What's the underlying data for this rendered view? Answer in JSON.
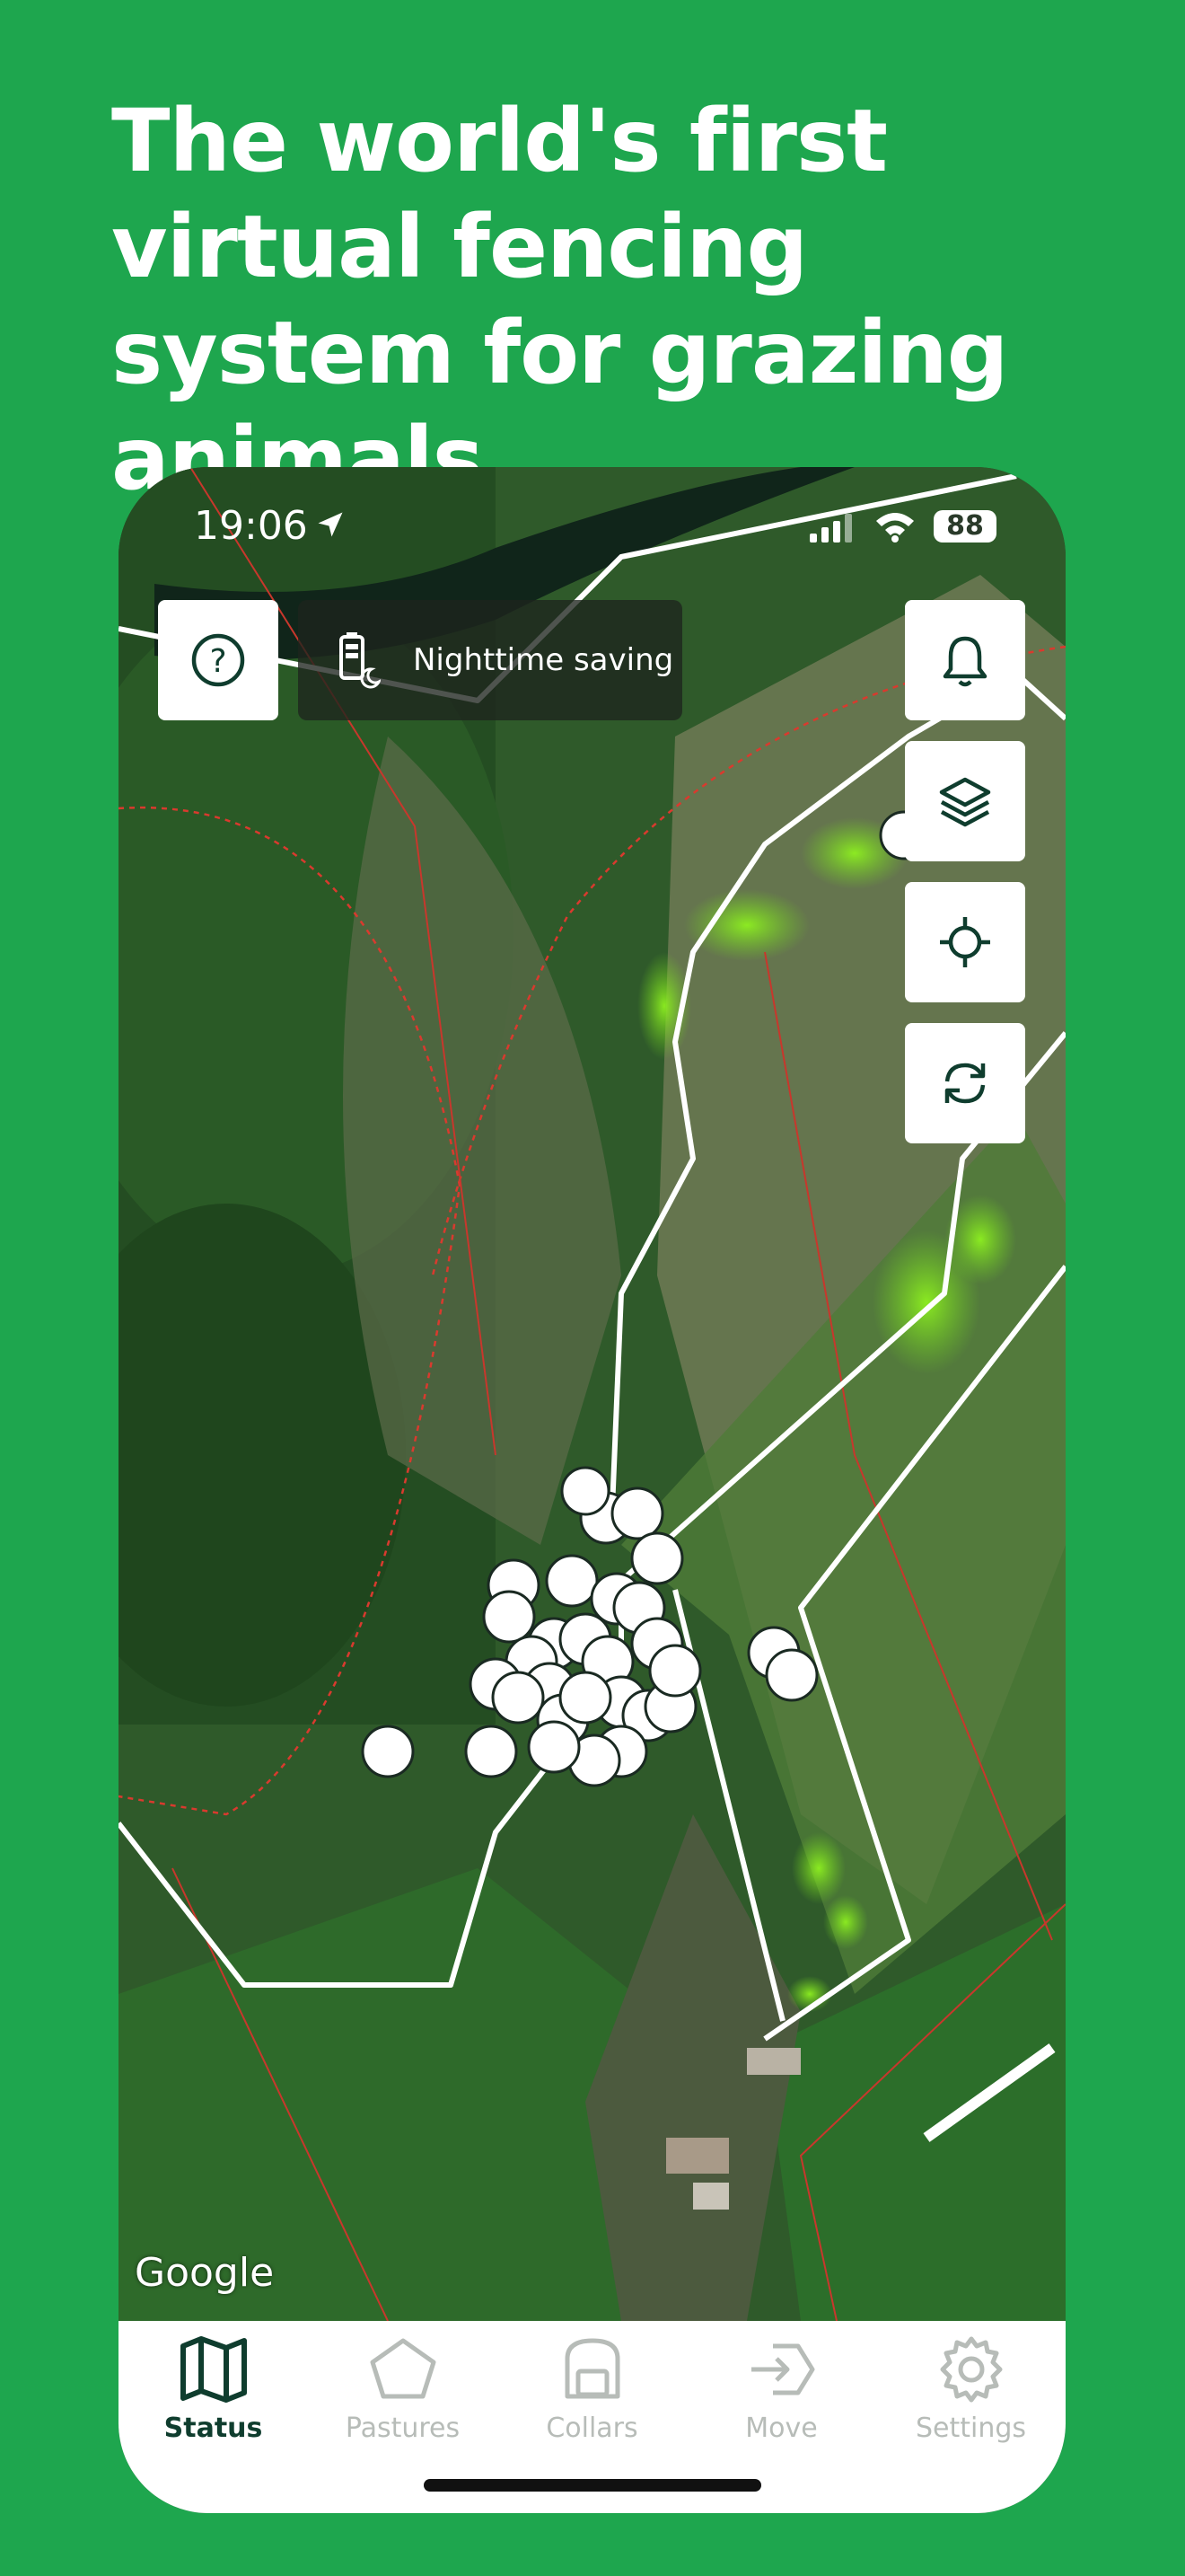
{
  "headline": "The world's first virtual fencing system for grazing animals",
  "status_bar": {
    "time": "19:06",
    "battery": "88"
  },
  "map": {
    "help_label": "?",
    "mode_badge": "Nighttime saving",
    "attribution": "Google",
    "tool_buttons": [
      "bell-icon",
      "layers-icon",
      "locate-icon",
      "refresh-icon"
    ]
  },
  "tabbar": {
    "tabs": [
      {
        "label": "Status",
        "icon": "map-icon",
        "active": true
      },
      {
        "label": "Pastures",
        "icon": "pentagon-icon",
        "active": false
      },
      {
        "label": "Collars",
        "icon": "collar-icon",
        "active": false
      },
      {
        "label": "Move",
        "icon": "move-icon",
        "active": false
      },
      {
        "label": "Settings",
        "icon": "gear-icon",
        "active": false
      }
    ]
  },
  "colors": {
    "background": "#1ea64e",
    "active_tab": "#0f3d2e",
    "inactive_tab": "#b7bcb8",
    "fence_line": "#ffffff",
    "boundary": "#d93a2e",
    "grazing_heat": "#7ee31f"
  }
}
